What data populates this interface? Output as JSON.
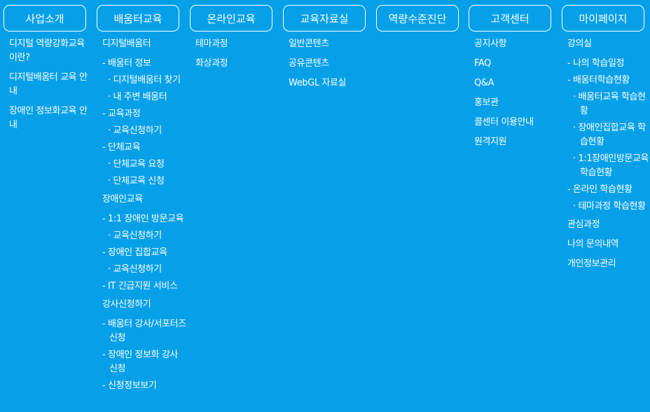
{
  "menus": [
    {
      "title": "사업소개",
      "items": [
        {
          "label": "디지털 역량강화교육 이란?",
          "level": 1
        },
        {
          "label": "디지털배움터 교육 안내",
          "level": 1
        },
        {
          "label": "장애인 정보화교육 안내",
          "level": 1
        }
      ]
    },
    {
      "title": "배움터교육",
      "items": [
        {
          "label": "디지털배움터",
          "level": 1
        },
        {
          "label": "- 배움터 정보",
          "level": 2
        },
        {
          "label": "· 디지털배움터 찾기",
          "level": 3
        },
        {
          "label": "· 내 주변 배움터",
          "level": 3
        },
        {
          "label": "- 교육과정",
          "level": 2
        },
        {
          "label": "· 교육신청하기",
          "level": 3
        },
        {
          "label": "- 단체교육",
          "level": 2
        },
        {
          "label": "· 단체교육 요청",
          "level": 3
        },
        {
          "label": "· 단체교육 신청",
          "level": 3
        },
        {
          "label": "장애인교육",
          "level": 1,
          "section": true
        },
        {
          "label": "- 1:1 장애인 방문교육",
          "level": 2
        },
        {
          "label": "· 교육신청하기",
          "level": 3
        },
        {
          "label": "- 장애인 집합교육",
          "level": 2
        },
        {
          "label": "· 교육신청하기",
          "level": 3
        },
        {
          "label": "- IT 긴급지원 서비스",
          "level": 2
        },
        {
          "label": "강사신청하기",
          "level": 1,
          "section": true
        },
        {
          "label": "- 배움터 강사/서포터즈 신청",
          "level": 2
        },
        {
          "label": "- 장애인 정보화 강사 신청",
          "level": 2
        },
        {
          "label": "- 신청정보보기",
          "level": 2
        }
      ]
    },
    {
      "title": "온라인교육",
      "items": [
        {
          "label": "테마과정",
          "level": 1
        },
        {
          "label": "화상과정",
          "level": 1
        }
      ]
    },
    {
      "title": "교육자료실",
      "items": [
        {
          "label": "일반콘텐츠",
          "level": 1
        },
        {
          "label": "공유콘텐츠",
          "level": 1
        },
        {
          "label": "WebGL 자료실",
          "level": 1
        }
      ]
    },
    {
      "title": "역량수준진단",
      "items": []
    },
    {
      "title": "고객센터",
      "items": [
        {
          "label": "공지사항",
          "level": 1
        },
        {
          "label": "FAQ",
          "level": 1
        },
        {
          "label": "Q&A",
          "level": 1
        },
        {
          "label": "홍보관",
          "level": 1
        },
        {
          "label": "콜센터 이용안내",
          "level": 1
        },
        {
          "label": "원격지원",
          "level": 1
        }
      ]
    },
    {
      "title": "마이페이지",
      "items": [
        {
          "label": "강의실",
          "level": 1
        },
        {
          "label": "- 나의 학습일정",
          "level": 2
        },
        {
          "label": "- 배움터학습현황",
          "level": 2
        },
        {
          "label": "· 배움터교육 학습현황",
          "level": 3
        },
        {
          "label": "· 장애인집합교육 학습현황",
          "level": 3
        },
        {
          "label": "· 1:1장애인방문교육 학습현황",
          "level": 3
        },
        {
          "label": "- 온라인 학습현황",
          "level": 2
        },
        {
          "label": "· 테마과정 학습현황",
          "level": 3
        },
        {
          "label": "관심과정",
          "level": 1,
          "section": true
        },
        {
          "label": "나의 문의내역",
          "level": 1
        },
        {
          "label": "개인정보관리",
          "level": 1
        }
      ]
    }
  ]
}
